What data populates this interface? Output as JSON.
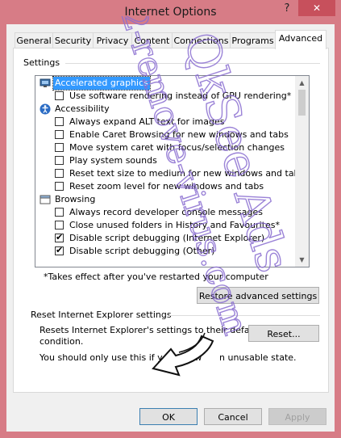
{
  "window": {
    "title": "Internet Options",
    "help_label": "?",
    "close_label": "✕"
  },
  "tabs": [
    {
      "label": "General"
    },
    {
      "label": "Security"
    },
    {
      "label": "Privacy"
    },
    {
      "label": "Content"
    },
    {
      "label": "Connections"
    },
    {
      "label": "Programs"
    },
    {
      "label": "Advanced",
      "active": true
    }
  ],
  "settings": {
    "group_label": "Settings",
    "items": [
      {
        "type": "category",
        "label": "Accelerated graphics",
        "icon": "monitor-icon",
        "selected": true
      },
      {
        "type": "checkbox",
        "label": "Use software rendering instead of GPU rendering*",
        "checked": false
      },
      {
        "type": "category",
        "label": "Accessibility",
        "icon": "accessibility-icon"
      },
      {
        "type": "checkbox",
        "label": "Always expand ALT text for images",
        "checked": false
      },
      {
        "type": "checkbox",
        "label": "Enable Caret Browsing for new windows and tabs",
        "checked": false
      },
      {
        "type": "checkbox",
        "label": "Move system caret with focus/selection changes",
        "checked": false
      },
      {
        "type": "checkbox",
        "label": "Play system sounds",
        "checked": false
      },
      {
        "type": "checkbox",
        "label": "Reset text size to medium for new windows and tabs",
        "checked": false
      },
      {
        "type": "checkbox",
        "label": "Reset zoom level for new windows and tabs",
        "checked": false
      },
      {
        "type": "category",
        "label": "Browsing",
        "icon": "browsing-icon"
      },
      {
        "type": "checkbox",
        "label": "Always record developer console messages",
        "checked": false
      },
      {
        "type": "checkbox",
        "label": "Close unused folders in History and Favourites*",
        "checked": false
      },
      {
        "type": "checkbox",
        "label": "Disable script debugging (Internet Explorer)",
        "checked": true
      },
      {
        "type": "checkbox",
        "label": "Disable script debugging (Other)",
        "checked": true
      }
    ],
    "footnote": "*Takes effect after you've restarted your computer",
    "restore_button": "Restore advanced settings"
  },
  "reset": {
    "group_label": "Reset Internet Explorer settings",
    "description_line1": "Resets Internet Explorer's settings to their default",
    "description_line2": "condition.",
    "warning_visible": "You should only use this if your brow",
    "warning_tail": "n unusable state.",
    "reset_button": "Reset..."
  },
  "footer": {
    "ok": "OK",
    "cancel": "Cancel",
    "apply": "Apply"
  },
  "watermark": {
    "line1": "QkSee Ads",
    "line2": "2-remove-virus.com",
    "color": "#8a6ed1"
  },
  "colors": {
    "frame": "#d77c86",
    "close_button": "#c7505c",
    "selection": "#3399ff",
    "dialog_bg": "#f0f0f0"
  }
}
